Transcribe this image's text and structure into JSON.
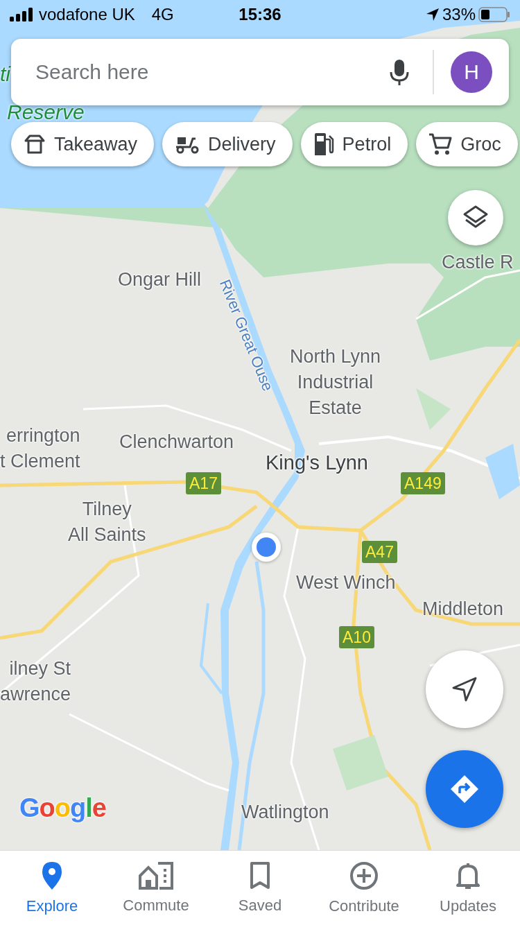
{
  "status_bar": {
    "carrier": "vodafone UK",
    "network": "4G",
    "time": "15:36",
    "battery": "33%"
  },
  "search": {
    "placeholder": "Search here",
    "avatar": "H"
  },
  "chips": [
    {
      "label": "Takeaway",
      "kind": "takeaway"
    },
    {
      "label": "Delivery",
      "kind": "delivery"
    },
    {
      "label": "Petrol",
      "kind": "petrol"
    },
    {
      "label": "Groc",
      "kind": "grocery"
    }
  ],
  "map": {
    "labels": [
      {
        "lines": [
          "ti"
        ],
        "kind": "park"
      },
      {
        "lines": [
          "Reserve"
        ],
        "kind": "park"
      },
      {
        "lines": [
          "Castle R"
        ],
        "kind": "place"
      },
      {
        "lines": [
          "Ongar Hill"
        ],
        "kind": "place"
      },
      {
        "lines": [
          "River Great Ouse"
        ],
        "kind": "river"
      },
      {
        "lines": [
          "North Lynn",
          "Industrial",
          "Estate"
        ],
        "kind": "place"
      },
      {
        "lines": [
          "errington",
          "t Clement"
        ],
        "kind": "place-left"
      },
      {
        "lines": [
          "Clenchwarton"
        ],
        "kind": "place"
      },
      {
        "lines": [
          "King's Lynn"
        ],
        "kind": "town"
      },
      {
        "lines": [
          "Tilney",
          "All Saints"
        ],
        "kind": "place"
      },
      {
        "lines": [
          "West Winch"
        ],
        "kind": "place"
      },
      {
        "lines": [
          "Middleton"
        ],
        "kind": "place"
      },
      {
        "lines": [
          "ilney St",
          "awrence"
        ],
        "kind": "place-left"
      },
      {
        "lines": [
          "Watlington"
        ],
        "kind": "place"
      }
    ],
    "roads": [
      {
        "label": "A17"
      },
      {
        "label": "A149"
      },
      {
        "label": "A47"
      },
      {
        "label": "A10"
      }
    ],
    "logo": "Google"
  },
  "nav": [
    {
      "label": "Explore",
      "kind": "explore",
      "selected": true
    },
    {
      "label": "Commute",
      "kind": "commute",
      "selected": false
    },
    {
      "label": "Saved",
      "kind": "saved",
      "selected": false
    },
    {
      "label": "Contribute",
      "kind": "contribute",
      "selected": false
    },
    {
      "label": "Updates",
      "kind": "updates",
      "selected": false
    }
  ]
}
